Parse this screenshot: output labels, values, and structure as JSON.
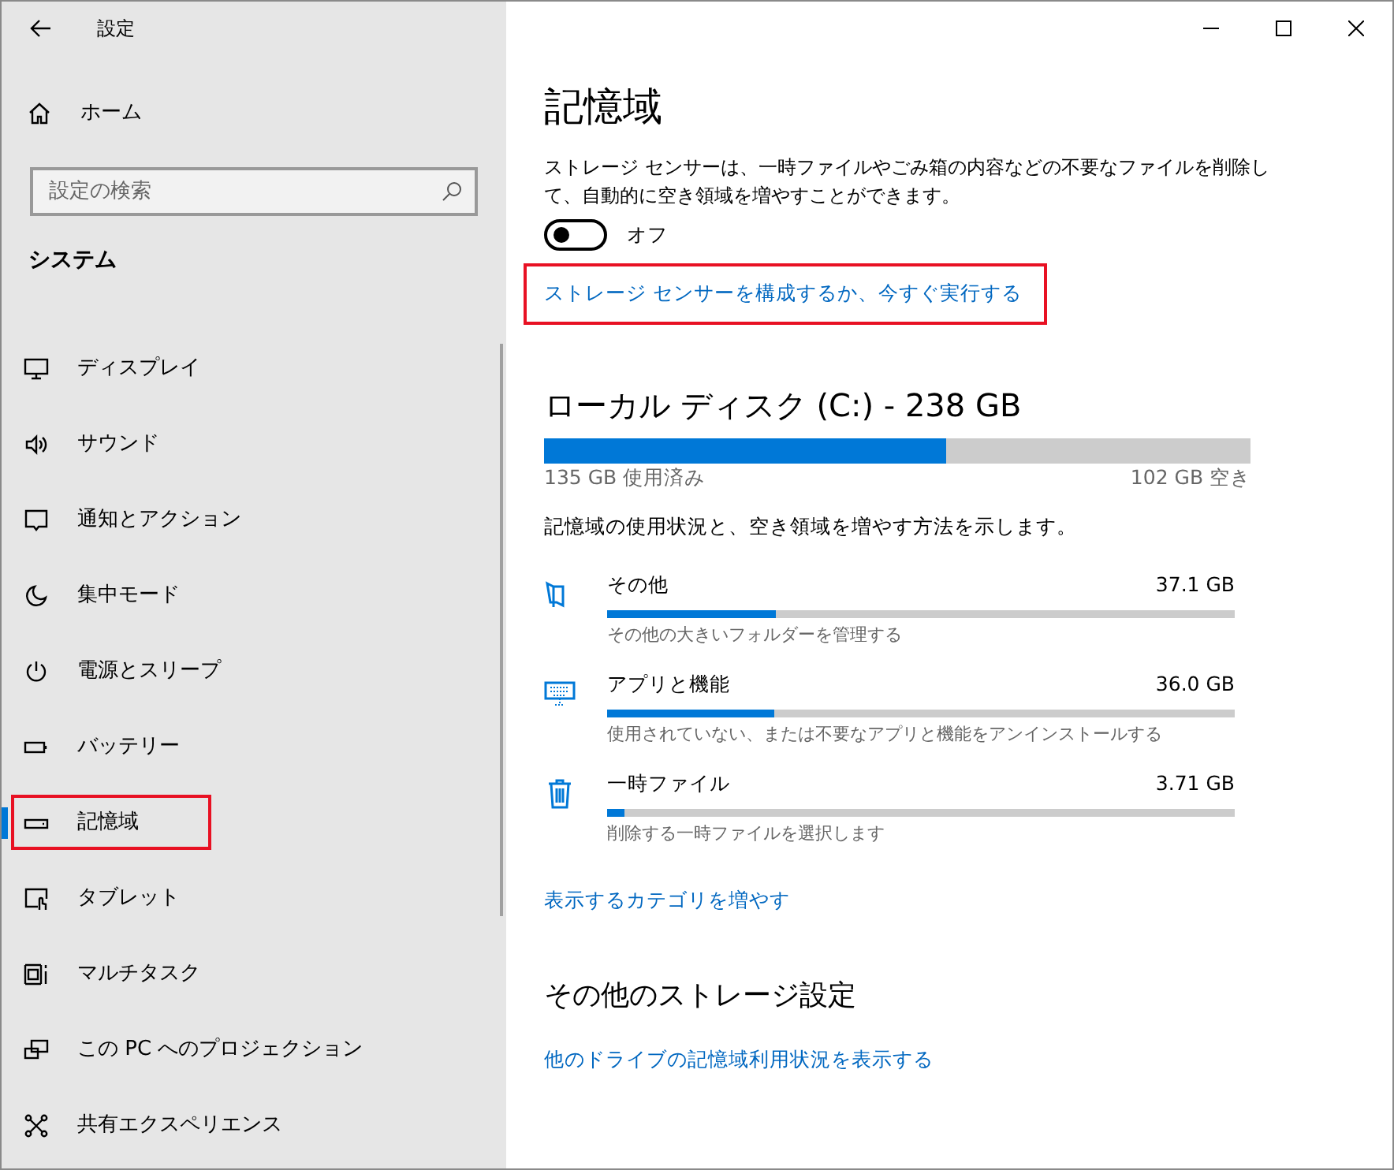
{
  "window": {
    "title": "設定"
  },
  "sidebar": {
    "home": "ホーム",
    "search": {
      "placeholder": "設定の検索"
    },
    "section": "システム",
    "items": [
      {
        "label": "ディスプレイ",
        "kind": "display",
        "selected": false,
        "highlighted": false
      },
      {
        "label": "サウンド",
        "kind": "sound",
        "selected": false,
        "highlighted": false
      },
      {
        "label": "通知とアクション",
        "kind": "notify",
        "selected": false,
        "highlighted": false
      },
      {
        "label": "集中モード",
        "kind": "moon",
        "selected": false,
        "highlighted": false
      },
      {
        "label": "電源とスリープ",
        "kind": "power",
        "selected": false,
        "highlighted": false
      },
      {
        "label": "バッテリー",
        "kind": "battery",
        "selected": false,
        "highlighted": false
      },
      {
        "label": "記憶域",
        "kind": "storage",
        "selected": true,
        "highlighted": true
      },
      {
        "label": "タブレット",
        "kind": "tablet",
        "selected": false,
        "highlighted": false
      },
      {
        "label": "マルチタスク",
        "kind": "multitask",
        "selected": false,
        "highlighted": false
      },
      {
        "label": "この PC へのプロジェクション",
        "kind": "project",
        "selected": false,
        "highlighted": false
      },
      {
        "label": "共有エクスペリエンス",
        "kind": "share",
        "selected": false,
        "highlighted": false
      }
    ]
  },
  "main": {
    "title": "記憶域",
    "description": "ストレージ センサーは、一時ファイルやごみ箱の内容などの不要なファイルを削除して、自動的に空き領域を増やすことができます。",
    "toggle": {
      "on": false,
      "label": "オフ"
    },
    "sensor_link": {
      "text": "ストレージ センサーを構成するか、今すぐ実行する",
      "highlighted": true
    },
    "disk": {
      "title": "ローカル ディスク (C:) - 238 GB",
      "level": 0.57,
      "used": "135 GB 使用済み",
      "free": "102 GB 空き"
    },
    "usage_note": "記憶域の使用状況と、空き領域を増やす方法を示します。",
    "categories": [
      {
        "kind": "folder",
        "name": "その他",
        "size": "37.1 GB",
        "level": 0.27,
        "hint": "その他の大きいフォルダーを管理する"
      },
      {
        "kind": "apps",
        "name": "アプリと機能",
        "size": "36.0 GB",
        "level": 0.266,
        "hint": "使用されていない、または不要なアプリと機能をアンインストールする"
      },
      {
        "kind": "trash",
        "name": "一時ファイル",
        "size": "3.71 GB",
        "level": 0.028,
        "hint": "削除する一時ファイルを選択します"
      }
    ],
    "more_link": "表示するカテゴリを増やす",
    "other_title": "その他のストレージ設定",
    "other_link": "他のドライブの記憶域利用状況を表示する"
  }
}
